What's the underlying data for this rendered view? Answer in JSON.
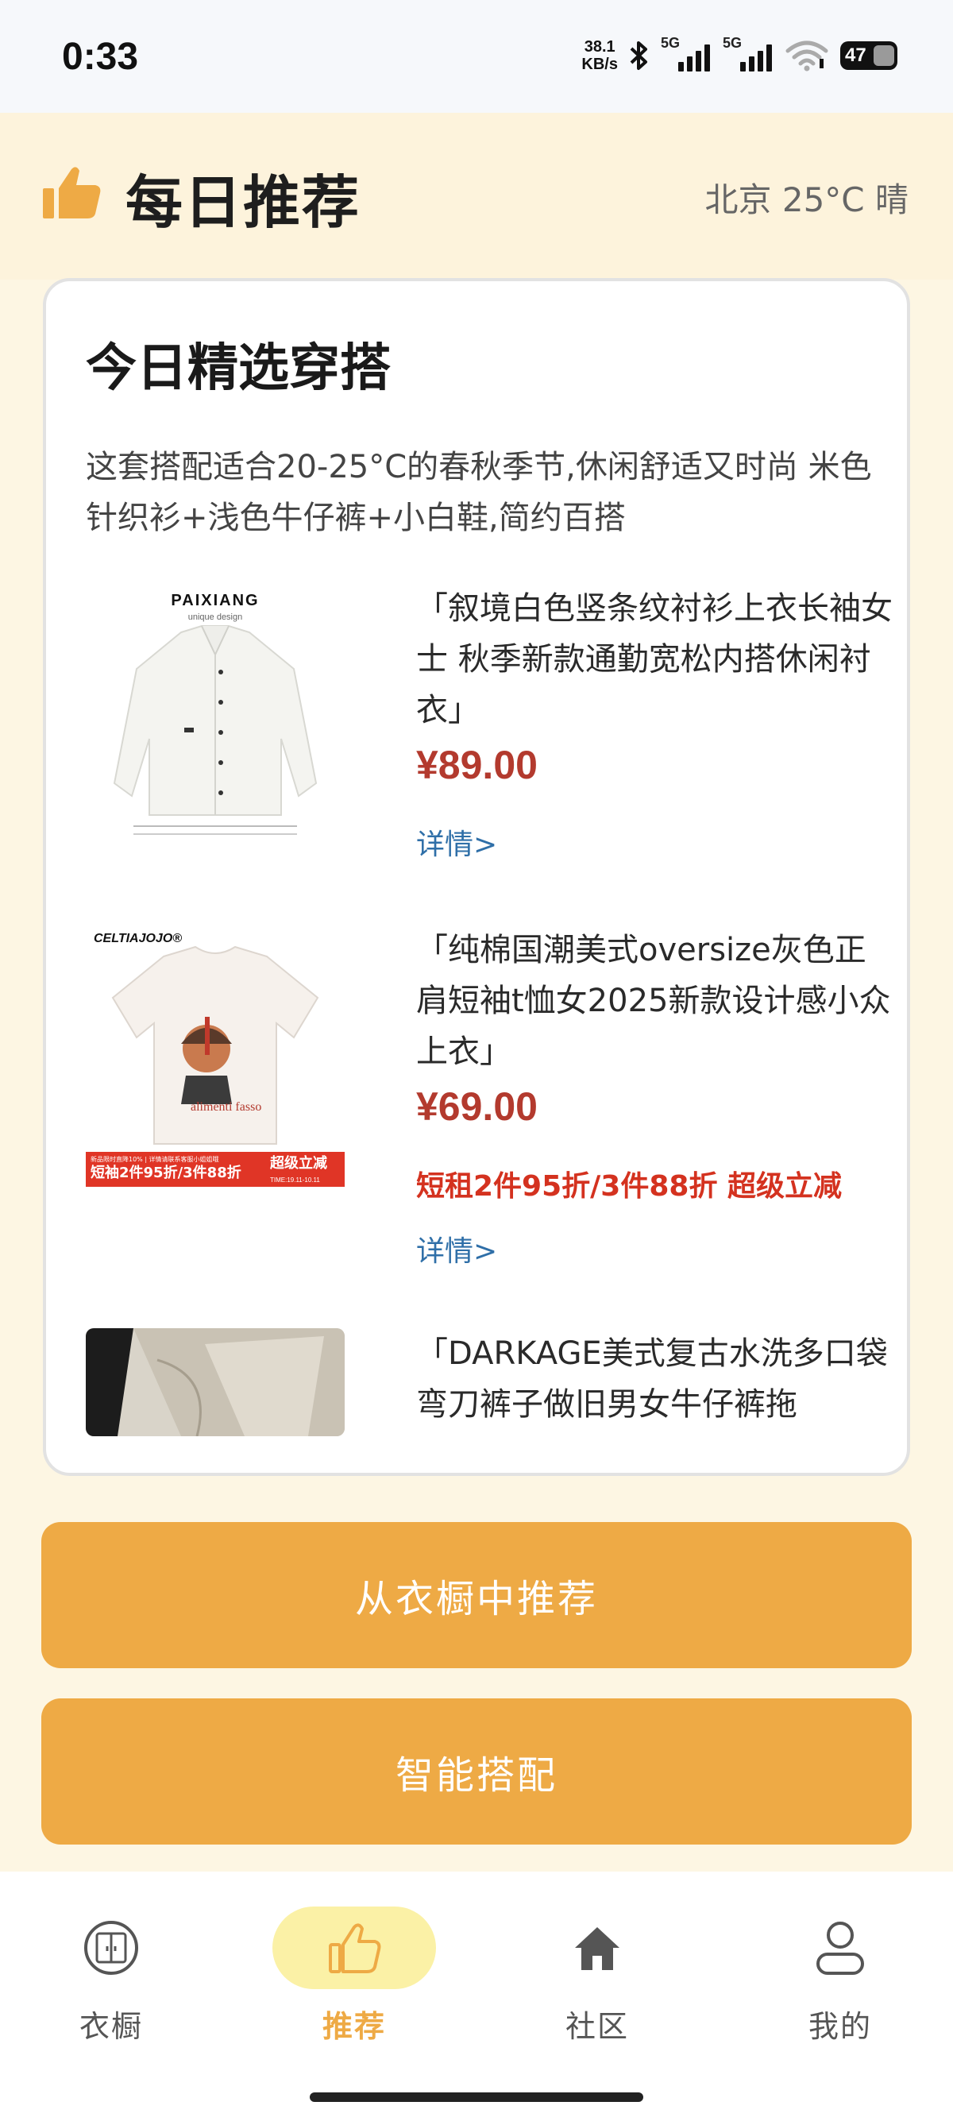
{
  "status_bar": {
    "time": "0:33",
    "net_speed_value": "38.1",
    "net_speed_unit": "KB/s",
    "signal_1_label": "5G",
    "signal_2_label": "5G",
    "battery": "47"
  },
  "header": {
    "title": "每日推荐",
    "weather": "北京 25°C 晴"
  },
  "card": {
    "title": "今日精选穿搭",
    "description": "这套搭配适合20-25°C的春秋季节,休闲舒适又时尚 米色针织衫+浅色牛仔裤+小白鞋,简约百搭",
    "products": [
      {
        "brand": "PAIXIANG",
        "brand_sub": "unique design",
        "name": "「叙境白色竖条纹衬衫上衣长袖女士 秋季新款通勤宽松内搭休闲衬衣」",
        "price": "¥89.00",
        "detail": "详情>"
      },
      {
        "brand": "CELTIAJOJO®",
        "shirt_text": "alimenti fasso",
        "banner_top": "新品限时直降10% | 详情请联系客服小姐姐哦",
        "banner_main": "短袖2件95折/3件88折",
        "banner_right": "超级立减",
        "banner_time": "TIME:19.11-10.11",
        "name": "「纯棉国潮美式oversize灰色正肩短袖t恤女2025新款设计感小众上衣」",
        "price": "¥69.00",
        "promo": "短租2件95折/3件88折 超级立减",
        "detail": "详情>"
      },
      {
        "name": "「DARKAGE美式复古水洗多口袋弯刀裤子做旧男女牛仔裤拖"
      }
    ]
  },
  "buttons": {
    "wardrobe_recommend": "从衣橱中推荐",
    "smart_match": "智能搭配"
  },
  "nav": {
    "items": [
      {
        "label": "衣橱",
        "icon": "wardrobe-icon"
      },
      {
        "label": "推荐",
        "icon": "thumbs-up-icon"
      },
      {
        "label": "社区",
        "icon": "home-icon"
      },
      {
        "label": "我的",
        "icon": "person-icon"
      }
    ],
    "active_index": 1
  },
  "colors": {
    "accent": "#eeaa45",
    "price": "#b33a2e",
    "promo": "#d4321f",
    "link": "#2f6fa8",
    "background": "#fdf3dc"
  }
}
